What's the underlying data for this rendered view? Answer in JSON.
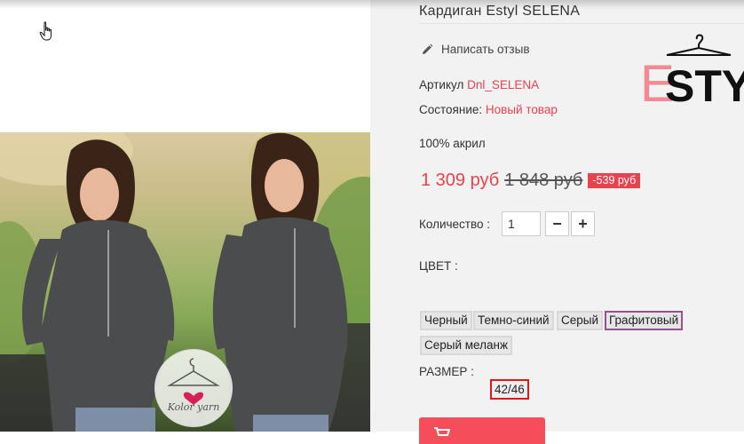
{
  "product": {
    "title": "Кардиган Estyl SELENA",
    "review_link": "Написать отзыв",
    "article_label": "Артикул",
    "article_value": "Dnl_SELENA",
    "condition_label": "Состояние:",
    "condition_value": "Новый товар",
    "composition": "100% акрил"
  },
  "brand": {
    "logo_text_e": "E",
    "logo_text": "STYL"
  },
  "price": {
    "current": "1 309 руб",
    "old": "1 848 руб",
    "discount_badge": "-539 руб"
  },
  "quantity": {
    "label": "Количество :",
    "value": "1",
    "minus": "−",
    "plus": "+"
  },
  "colors": {
    "label": "ЦВЕТ :",
    "options": [
      "Черный",
      "Темно-синий",
      "Серый",
      "Графитовый",
      "Серый меланж"
    ],
    "selected": "Графитовый"
  },
  "sizes": {
    "label": "РАЗМЕР :",
    "options": [
      "42/46"
    ],
    "selected": "42/46"
  },
  "watermark": {
    "text": "Kolor yarn"
  },
  "colors_theme": {
    "accent": "#e8424f",
    "selected_swatch_border": "#9a4f8e",
    "selected_size_border": "#e01818",
    "panel_bg": "#f2f2f2"
  }
}
